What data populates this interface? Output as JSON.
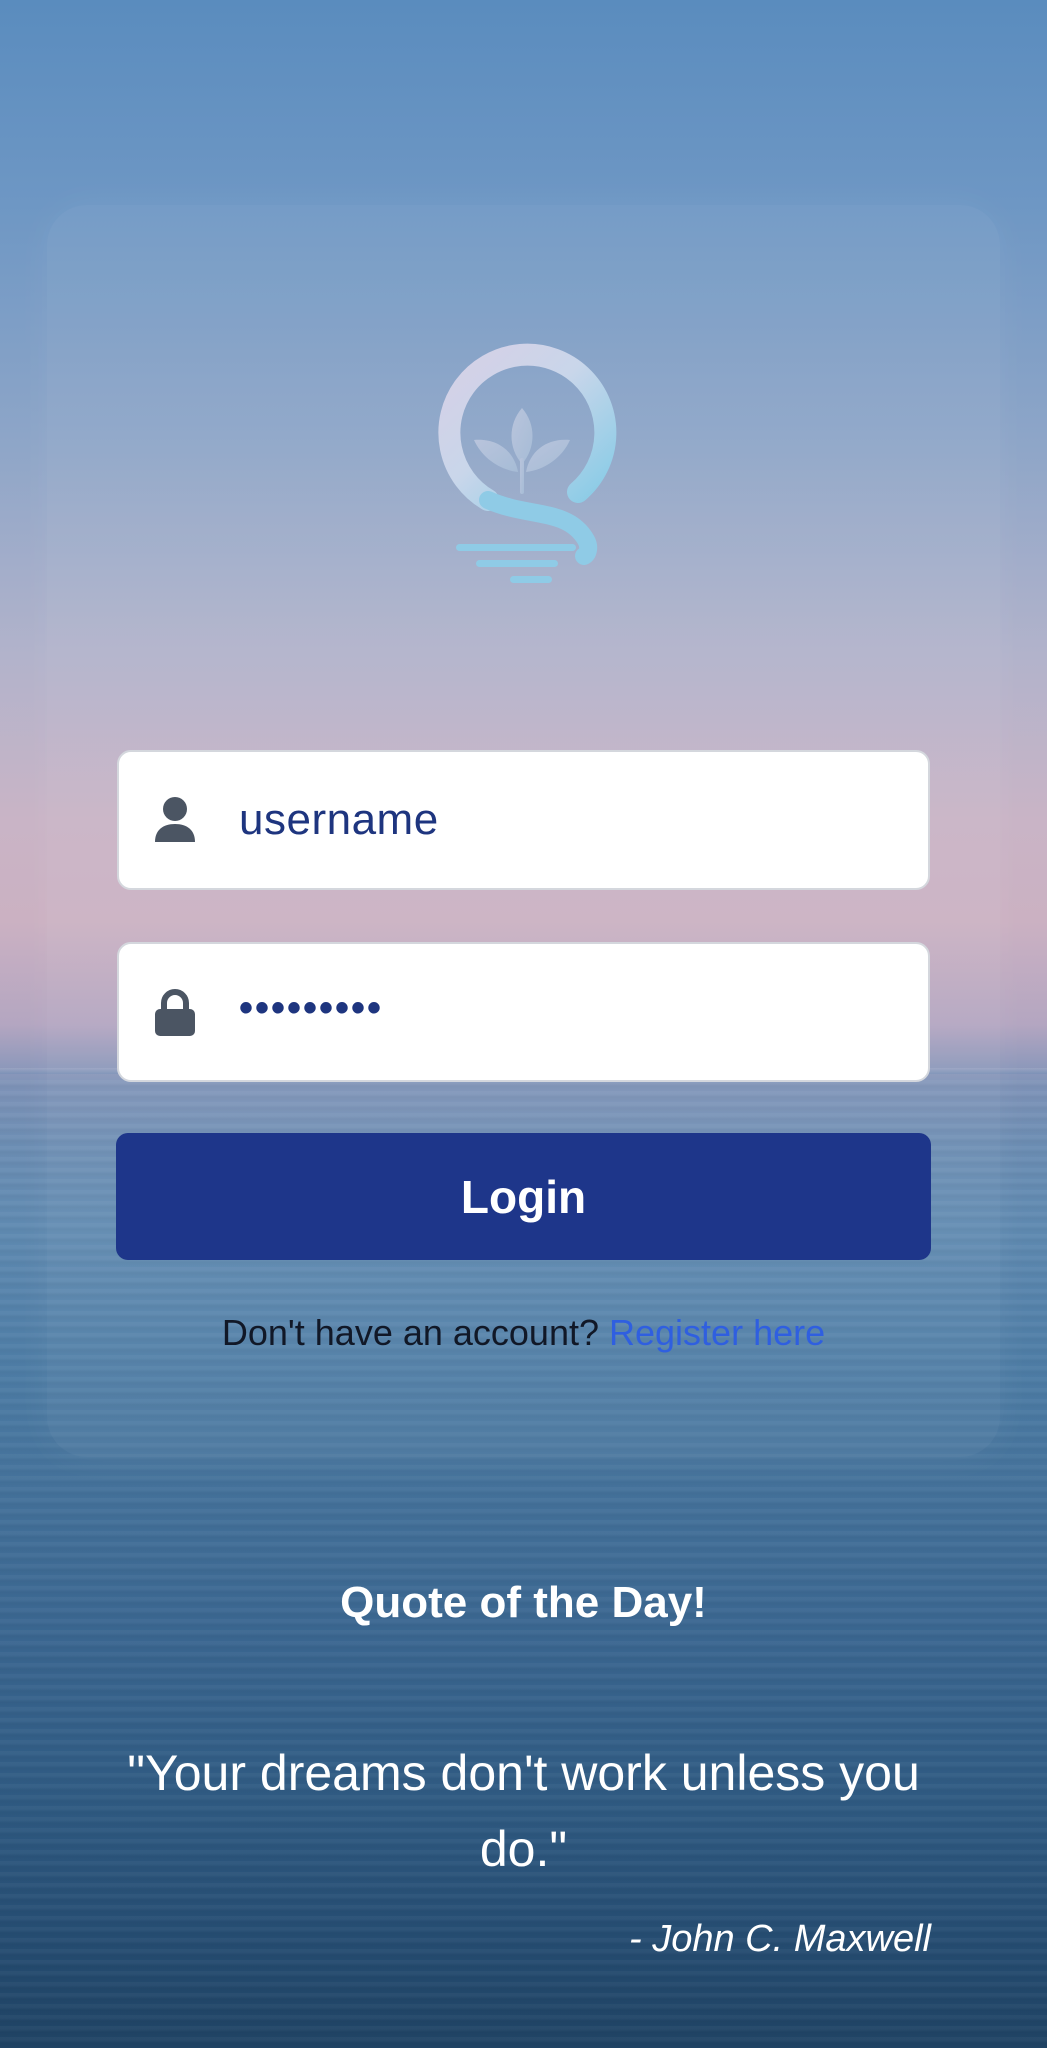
{
  "colors": {
    "primary": "#1e368a",
    "link": "#2f5fe0",
    "input_text": "#1e357f",
    "icon": "#4b5563"
  },
  "logo": {
    "icon": "sprout-in-q-logo"
  },
  "login_form": {
    "username": {
      "icon": "user-icon",
      "value": "username"
    },
    "password": {
      "icon": "lock-icon",
      "value": "•••••••••"
    },
    "login_label": "Login",
    "register_prompt": "Don't have an account?",
    "register_link": "Register here"
  },
  "quote": {
    "title": "Quote of the Day!",
    "text": "\"Your dreams don't work unless you do.\"",
    "author": "- John C. Maxwell"
  }
}
